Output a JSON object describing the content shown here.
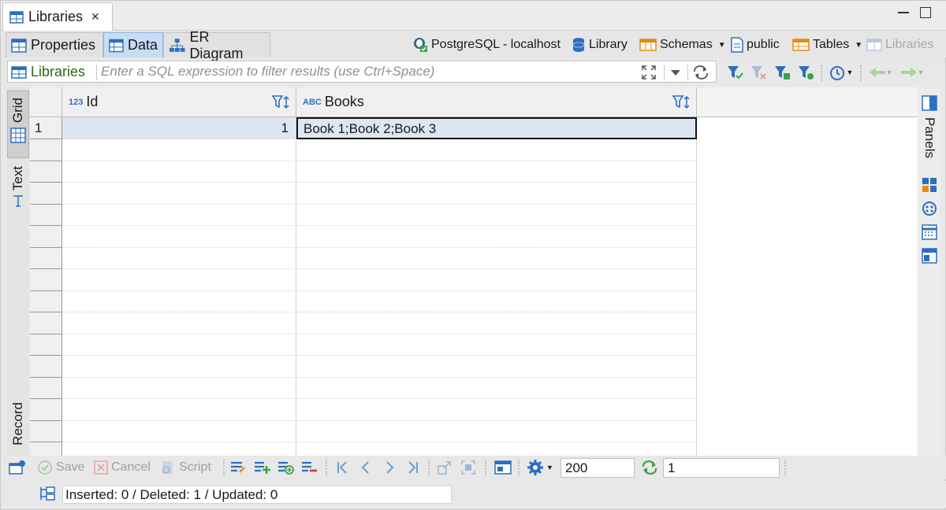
{
  "editor_tab": {
    "title": "Libraries",
    "close_icon": "close-icon"
  },
  "subtabs": [
    {
      "label": "Properties",
      "icon": "properties-icon",
      "active": false
    },
    {
      "label": "Data",
      "icon": "data-grid-icon",
      "active": true
    },
    {
      "label": "ER Diagram",
      "icon": "er-diagram-icon",
      "active": false
    }
  ],
  "breadcrumb": {
    "connection": "PostgreSQL - localhost",
    "database": "Library",
    "schemas": "Schemas",
    "schema": "public",
    "tables": "Tables",
    "table": "Libraries"
  },
  "filter": {
    "entity": "Libraries",
    "placeholder": "Enter a SQL expression to filter results (use Ctrl+Space)"
  },
  "left_tabs": {
    "grid": "Grid",
    "text": "Text",
    "record": "Record"
  },
  "right_panel": {
    "label": "Panels"
  },
  "grid": {
    "columns": [
      {
        "type": "123",
        "name": "Id"
      },
      {
        "type": "ABC",
        "name": "Books"
      }
    ],
    "rows": [
      {
        "num": "1",
        "id": "1",
        "books": "Book 1;Book 2;Book 3"
      }
    ]
  },
  "bottom": {
    "save": "Save",
    "cancel": "Cancel",
    "script": "Script",
    "fetch_size": "200",
    "row_count": "1"
  },
  "status": "Inserted: 0 / Deleted: 1 / Updated: 0",
  "colors": {
    "accent": "#2c6fc0",
    "selection": "#dde6f1",
    "filter_green": "#2b6a13"
  }
}
